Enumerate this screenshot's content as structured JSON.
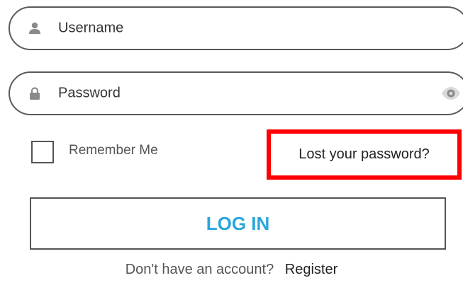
{
  "login_form": {
    "username": {
      "placeholder": "Username",
      "icon": "user-icon"
    },
    "password": {
      "placeholder": "Password",
      "icon": "lock-icon",
      "toggle_icon": "eye-icon"
    },
    "remember_me": {
      "label": "Remember Me",
      "checked": false
    },
    "lost_password_link": "Lost your password?",
    "submit_label": "LOG IN",
    "footer": {
      "prompt": "Don't have an account?",
      "register_link": "Register"
    }
  },
  "colors": {
    "accent": "#29a6d9",
    "highlight_box": "#ff0000",
    "border": "#555555",
    "icon_gray": "#8a8a8a"
  }
}
